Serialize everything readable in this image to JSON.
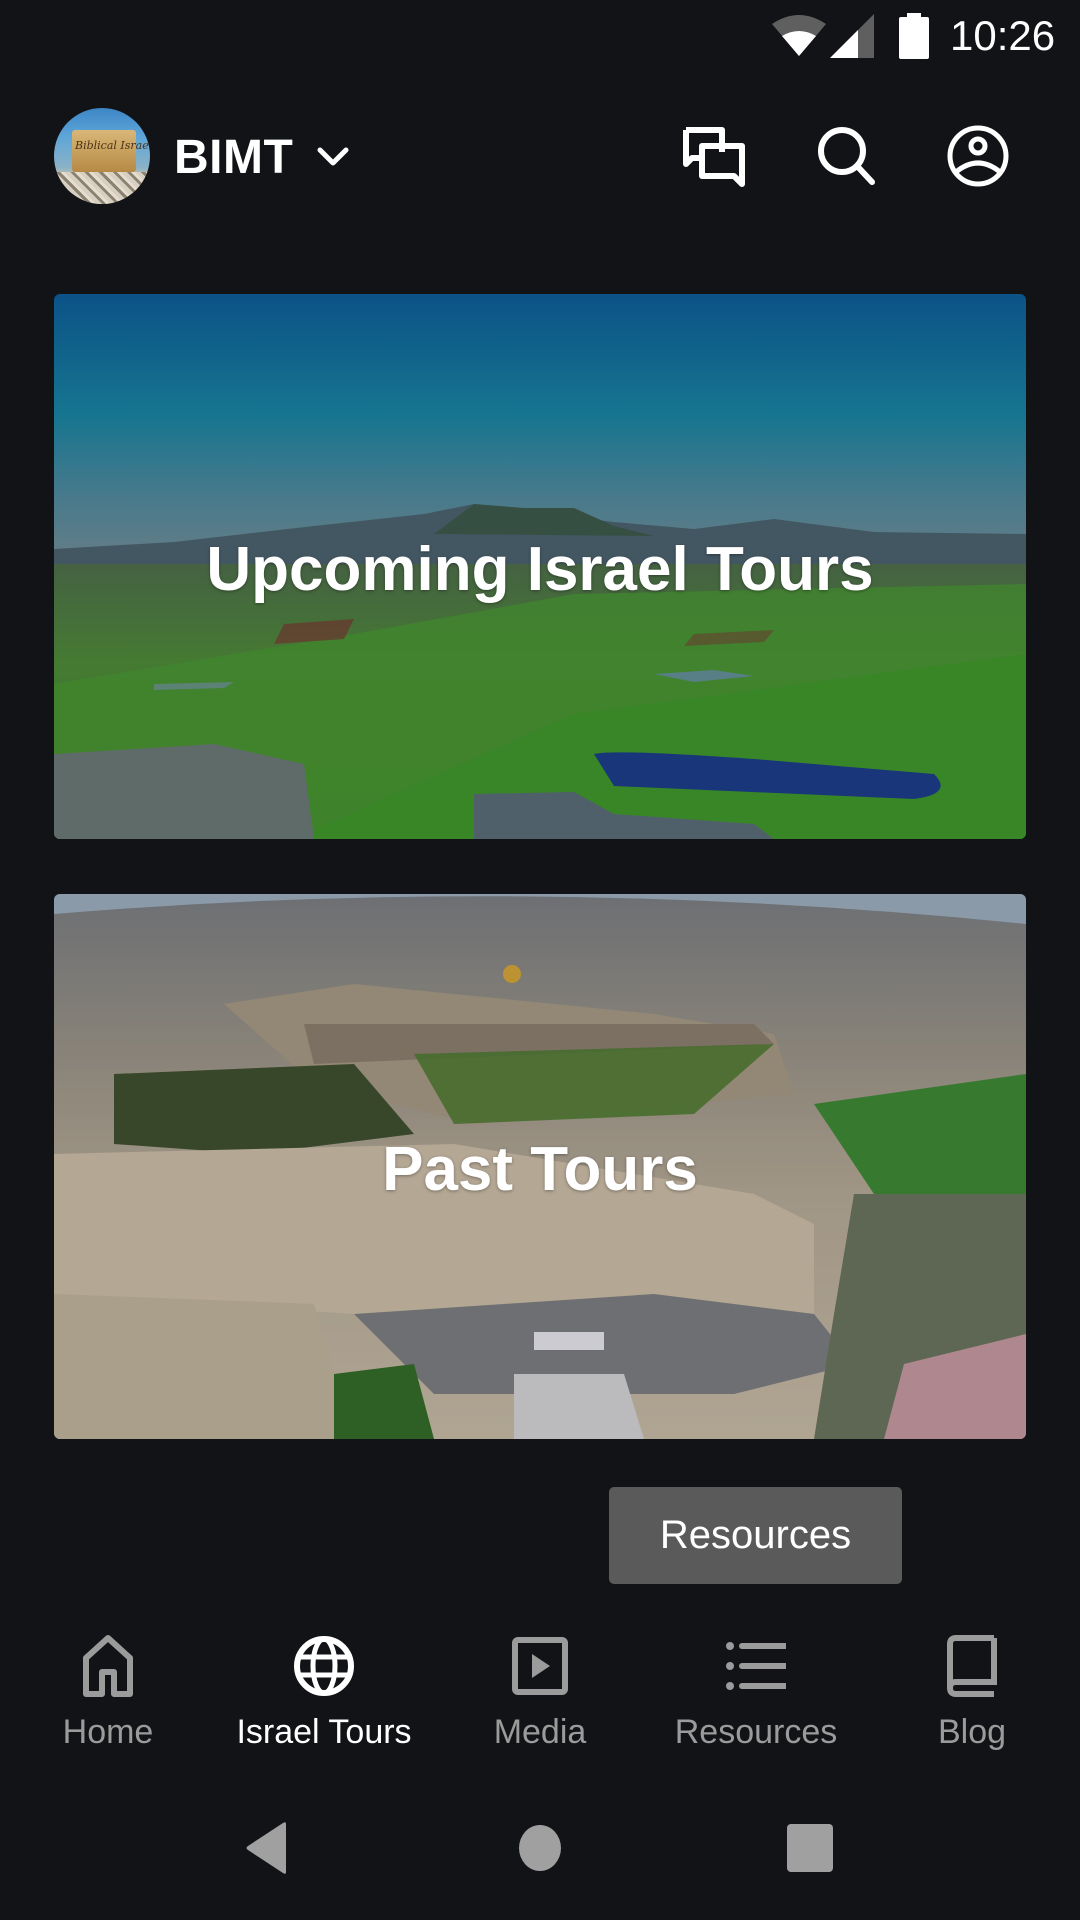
{
  "status_bar": {
    "time": "10:26",
    "icons": [
      "wifi-icon",
      "cellular-signal-icon",
      "battery-icon"
    ]
  },
  "app_bar": {
    "brand": "BIMT",
    "avatar_logo_text": "Biblical Israel",
    "actions": [
      {
        "name": "chat",
        "icon": "chat-bubbles-icon"
      },
      {
        "name": "search",
        "icon": "search-icon"
      },
      {
        "name": "profile",
        "icon": "account-circle-icon"
      }
    ]
  },
  "cards": [
    {
      "title": "Upcoming Israel Tours",
      "image": "aerial view of green valley fields and mountain"
    },
    {
      "title": "Past Tours",
      "image": "aerial view of Jerusalem old city and Mount of Olives"
    }
  ],
  "tooltip": {
    "text": "Resources"
  },
  "bottom_nav": {
    "active_index": 1,
    "tabs": [
      {
        "label": "Home",
        "icon": "home-icon"
      },
      {
        "label": "Israel Tours",
        "icon": "globe-icon"
      },
      {
        "label": "Media",
        "icon": "play-video-icon"
      },
      {
        "label": "Resources",
        "icon": "list-icon"
      },
      {
        "label": "Blog",
        "icon": "book-icon"
      }
    ]
  },
  "colors": {
    "background": "#121316",
    "active_tab": "#ffffff",
    "inactive_tab": "#9b9b9b",
    "tooltip_bg": "#5a5a5a",
    "system_nav": "#a0a0a0"
  }
}
